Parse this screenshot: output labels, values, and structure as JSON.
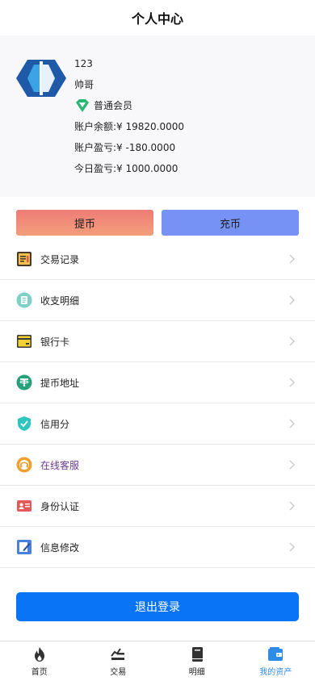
{
  "header": {
    "title": "个人中心"
  },
  "profile": {
    "id": "123",
    "name": "帅哥",
    "member_level": "普通会员",
    "balance_label": "账户余额:",
    "balance_value": "¥  19820.0000",
    "pnl_label": "账户盈亏:",
    "pnl_value": "¥  -180.0000",
    "today_label": "今日盈亏:",
    "today_value": "¥  1000.0000"
  },
  "actions": {
    "withdraw_label": "提币",
    "deposit_label": "充币"
  },
  "menu": [
    {
      "label": "交易记录",
      "icon": "ledger-icon"
    },
    {
      "label": "收支明细",
      "icon": "list-detail-icon"
    },
    {
      "label": "银行卡",
      "icon": "bank-card-icon"
    },
    {
      "label": "提币地址",
      "icon": "tether-icon"
    },
    {
      "label": "信用分",
      "icon": "shield-check-icon"
    },
    {
      "label": "在线客服",
      "icon": "headset-icon"
    },
    {
      "label": "身份认证",
      "icon": "id-card-icon"
    },
    {
      "label": "信息修改",
      "icon": "edit-icon"
    }
  ],
  "logout_label": "退出登录",
  "tabs": [
    {
      "label": "首页",
      "icon": "flame-icon",
      "active": false
    },
    {
      "label": "交易",
      "icon": "trade-icon",
      "active": false
    },
    {
      "label": "明细",
      "icon": "book-icon",
      "active": false
    },
    {
      "label": "我的资产",
      "icon": "wallet-icon",
      "active": true
    }
  ],
  "colors": {
    "primary": "#0a74f6",
    "withdraw_gradient_top": "#ee7c78",
    "deposit": "#7592f4",
    "active_tab": "#2f8be8"
  }
}
